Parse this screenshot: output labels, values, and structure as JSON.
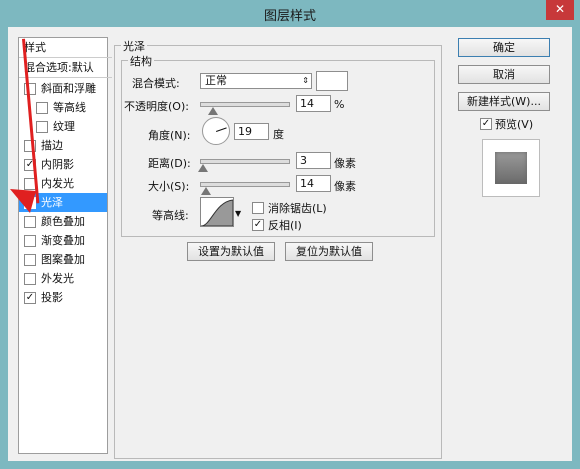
{
  "window": {
    "title": "图层样式",
    "close_glyph": "✕"
  },
  "left_panel": {
    "header1": "样式",
    "header2": "混合选项:默认",
    "items": [
      {
        "label": "斜面和浮雕",
        "checked": false
      },
      {
        "label": "等高线",
        "checked": false
      },
      {
        "label": "纹理",
        "checked": false
      },
      {
        "label": "描边",
        "checked": false
      },
      {
        "label": "内阴影",
        "checked": true
      },
      {
        "label": "内发光",
        "checked": false
      },
      {
        "label": "光泽",
        "checked": true,
        "selected": true
      },
      {
        "label": "颜色叠加",
        "checked": false
      },
      {
        "label": "渐变叠加",
        "checked": false
      },
      {
        "label": "图案叠加",
        "checked": false
      },
      {
        "label": "外发光",
        "checked": false
      },
      {
        "label": "投影",
        "checked": true
      }
    ],
    "check_glyph": "✓"
  },
  "satin": {
    "section_title": "光泽",
    "structure_title": "结构",
    "blend_mode_label": "混合模式:",
    "blend_mode_value": "正常",
    "blend_arrows": "⇕",
    "opacity_label": "不透明度(O):",
    "opacity_value": "14",
    "percent_unit": "%",
    "opacity_fraction": 0.14,
    "angle_label": "角度(N):",
    "angle_value": "19",
    "degree_unit": "度",
    "distance_label": "距离(D):",
    "distance_value": "3",
    "distance_fraction": 0.02,
    "pixel_unit": "像素",
    "size_label": "大小(S):",
    "size_value": "14",
    "size_fraction": 0.06,
    "contour_label": "等高线:",
    "anti_alias_label": "消除锯齿(L)",
    "anti_alias_checked": false,
    "invert_label": "反相(I)",
    "invert_checked": true,
    "set_default_button": "设置为默认值",
    "reset_default_button": "复位为默认值"
  },
  "right": {
    "ok_button": "确定",
    "cancel_button": "取消",
    "new_style_button": "新建样式(W)...",
    "preview_label": "预览(V)",
    "preview_checked": true
  },
  "colors": {
    "accent": "#3399ff",
    "arrow": "#e02020",
    "titlebar": "#7db8c0"
  }
}
